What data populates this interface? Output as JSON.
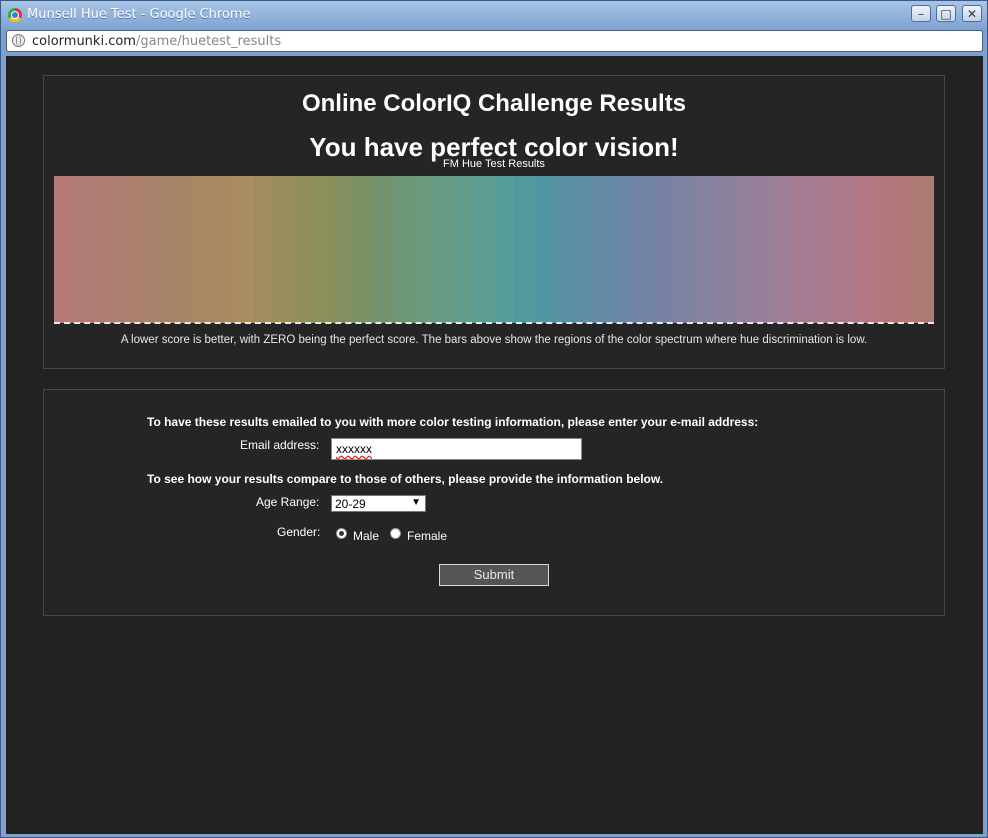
{
  "window": {
    "title": "Munsell Hue Test - Google Chrome"
  },
  "address_bar": {
    "domain": "colormunki.com",
    "path": "/game/huetest_results"
  },
  "results": {
    "heading": "Online ColorIQ Challenge Results",
    "verdict": "You have perfect color vision!",
    "chart_title": "FM Hue Test Results",
    "note": "A lower score is better, with ZERO being the perfect score. The bars above show the regions of the color spectrum where hue discrimination is low."
  },
  "form": {
    "email_prompt": "To have these results emailed to you with more color testing information, please enter your e-mail address:",
    "email_label": "Email address:",
    "email_value": "xxxxxx",
    "compare_prompt": "To see how your results compare to those of others, please provide the information below.",
    "age_label": "Age Range:",
    "age_value": "20-29",
    "gender_label": "Gender:",
    "gender_options": [
      "Male",
      "Female"
    ],
    "gender_selected": "Male",
    "submit_label": "Submit"
  },
  "spectrum_colors": [
    "#b57a79",
    "#b27c76",
    "#b07e73",
    "#ad7f70",
    "#aa816c",
    "#a78369",
    "#a68566",
    "#a88763",
    "#a98962",
    "#a98c61",
    "#a28c5f",
    "#9a8e5c",
    "#938f5a",
    "#8c8f5a",
    "#82905f",
    "#7a9166",
    "#72936d",
    "#6d9674",
    "#6a997c",
    "#689b84",
    "#649c8b",
    "#5d9d92",
    "#569d99",
    "#52999d",
    "#5395a0",
    "#5891a3",
    "#5e8ea5",
    "#648aa6",
    "#6a87a7",
    "#7184a5",
    "#7882a2",
    "#7e819f",
    "#85819e",
    "#8b809c",
    "#92809b",
    "#98809a",
    "#9e7f97",
    "#a47d93",
    "#a97b8e",
    "#ad7a89",
    "#b07983",
    "#b3787e",
    "#b1797a",
    "#ae7a76"
  ],
  "chart_data": {
    "type": "bar",
    "title": "FM Hue Test Results",
    "categories": [],
    "values": [],
    "note": "All error values are zero (perfect score); only the spectrum band is drawn."
  }
}
